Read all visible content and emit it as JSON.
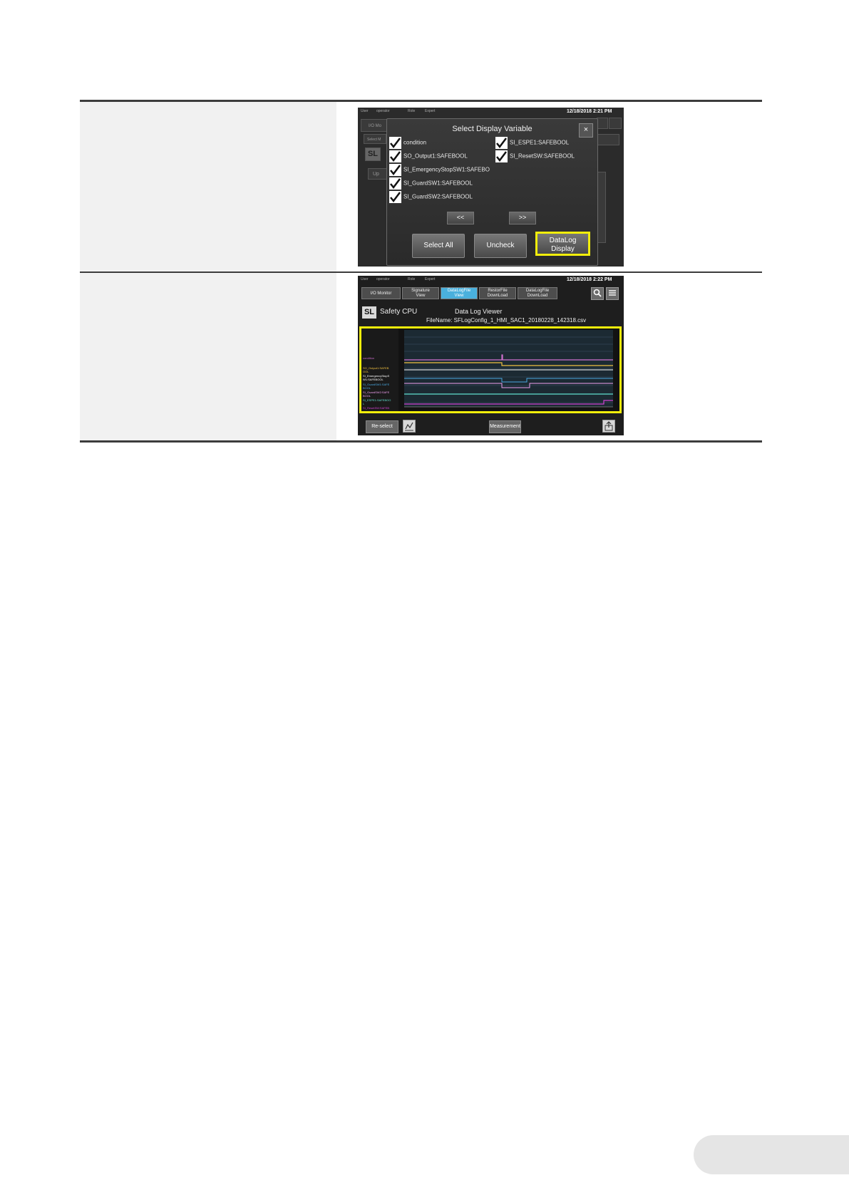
{
  "screen1": {
    "top_bar": {
      "user": "User",
      "operator": "operator",
      "role": "Role",
      "expert": "Expert",
      "datetime": "12/18/2018  2:21 PM"
    },
    "background": {
      "tab": "I/O Mo",
      "select": "Select M",
      "sl": "SL",
      "btn": "Up"
    },
    "dialog": {
      "title": "Select Display Variable",
      "close": "×",
      "variables_left": [
        "condition",
        "SO_Output1:SAFEBOOL",
        "SI_EmergencyStopSW1:SAFEBO",
        "SI_GuardSW1:SAFEBOOL",
        "SI_GuardSW2:SAFEBOOL"
      ],
      "variables_right": [
        "SI_ESPE1:SAFEBOOL",
        "SI_ResetSW:SAFEBOOL"
      ],
      "prev": "<<",
      "next": ">>",
      "select_all": "Select All",
      "uncheck": "Uncheck",
      "datalog_display": [
        "DataLog",
        "Display"
      ]
    }
  },
  "screen2": {
    "top_bar": {
      "user": "User",
      "operator": "operator",
      "role": "Role",
      "expert": "Expert",
      "datetime": "12/18/2018  2:22 PM"
    },
    "tabs": [
      [
        "I/O Monitor",
        ""
      ],
      [
        "Signature",
        "View"
      ],
      [
        "DataLogFile",
        "View"
      ],
      [
        "RestorFile",
        "DownLoad"
      ],
      [
        "DataLogFile",
        "DownLoad"
      ]
    ],
    "cpu_label": "Safety CPU",
    "sl": "SL",
    "viewer_title": "Data Log Viewer",
    "filename": "FileName:  SFLogConfig_1_HMI_SAC1_20180228_142318.csv",
    "legend": [
      "condition",
      "SO_Output1:SAFEB",
      "OOL",
      "SI_EmergencyStopS",
      "W1:SAFEBOOL",
      "SI_GuardSW1:SAFE",
      "BOOL",
      "SI_GuardSW2:SAFE",
      "BOOL",
      "SI_ESPE1:SAFEBOO",
      "L",
      "SI_ResetSW:SAFEB"
    ],
    "reselect": "Re-select",
    "measurement": "Measurement"
  }
}
